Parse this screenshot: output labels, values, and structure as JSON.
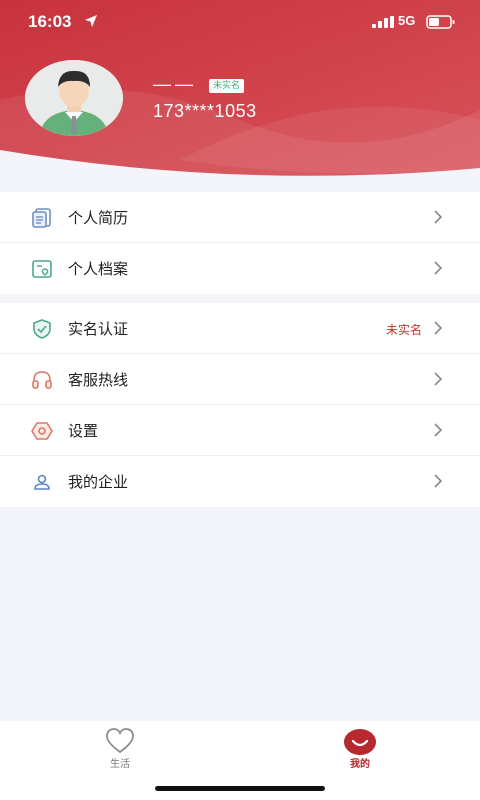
{
  "status_bar": {
    "time": "16:03",
    "network": "5G"
  },
  "profile": {
    "name": "——",
    "badge": "未实名",
    "phone": "173****1053"
  },
  "menu": {
    "group1": [
      {
        "label": "个人简历",
        "icon": "resume-icon"
      },
      {
        "label": "个人档案",
        "icon": "archive-icon"
      }
    ],
    "group2": [
      {
        "label": "实名认证",
        "icon": "shield-icon",
        "status": "未实名"
      },
      {
        "label": "客服热线",
        "icon": "headset-icon"
      },
      {
        "label": "设置",
        "icon": "gear-icon"
      },
      {
        "label": "我的企业",
        "icon": "user-icon"
      }
    ]
  },
  "tabbar": {
    "life": "生活",
    "mine": "我的"
  },
  "colors": {
    "brand": "#c9343f",
    "status_red": "#c0392b",
    "badge_green": "#3fae7a"
  }
}
